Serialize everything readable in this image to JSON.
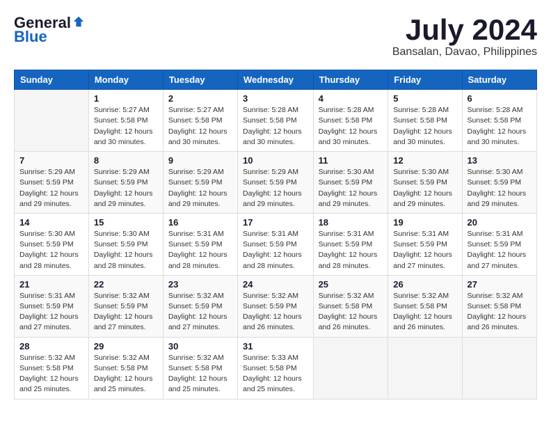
{
  "header": {
    "logo_general": "General",
    "logo_blue": "Blue",
    "month_year": "July 2024",
    "location": "Bansalan, Davao, Philippines"
  },
  "calendar": {
    "days_of_week": [
      "Sunday",
      "Monday",
      "Tuesday",
      "Wednesday",
      "Thursday",
      "Friday",
      "Saturday"
    ],
    "weeks": [
      [
        {
          "day": "",
          "info": ""
        },
        {
          "day": "1",
          "info": "Sunrise: 5:27 AM\nSunset: 5:58 PM\nDaylight: 12 hours\nand 30 minutes."
        },
        {
          "day": "2",
          "info": "Sunrise: 5:27 AM\nSunset: 5:58 PM\nDaylight: 12 hours\nand 30 minutes."
        },
        {
          "day": "3",
          "info": "Sunrise: 5:28 AM\nSunset: 5:58 PM\nDaylight: 12 hours\nand 30 minutes."
        },
        {
          "day": "4",
          "info": "Sunrise: 5:28 AM\nSunset: 5:58 PM\nDaylight: 12 hours\nand 30 minutes."
        },
        {
          "day": "5",
          "info": "Sunrise: 5:28 AM\nSunset: 5:58 PM\nDaylight: 12 hours\nand 30 minutes."
        },
        {
          "day": "6",
          "info": "Sunrise: 5:28 AM\nSunset: 5:58 PM\nDaylight: 12 hours\nand 30 minutes."
        }
      ],
      [
        {
          "day": "7",
          "info": "Sunrise: 5:29 AM\nSunset: 5:59 PM\nDaylight: 12 hours\nand 29 minutes."
        },
        {
          "day": "8",
          "info": "Sunrise: 5:29 AM\nSunset: 5:59 PM\nDaylight: 12 hours\nand 29 minutes."
        },
        {
          "day": "9",
          "info": "Sunrise: 5:29 AM\nSunset: 5:59 PM\nDaylight: 12 hours\nand 29 minutes."
        },
        {
          "day": "10",
          "info": "Sunrise: 5:29 AM\nSunset: 5:59 PM\nDaylight: 12 hours\nand 29 minutes."
        },
        {
          "day": "11",
          "info": "Sunrise: 5:30 AM\nSunset: 5:59 PM\nDaylight: 12 hours\nand 29 minutes."
        },
        {
          "day": "12",
          "info": "Sunrise: 5:30 AM\nSunset: 5:59 PM\nDaylight: 12 hours\nand 29 minutes."
        },
        {
          "day": "13",
          "info": "Sunrise: 5:30 AM\nSunset: 5:59 PM\nDaylight: 12 hours\nand 29 minutes."
        }
      ],
      [
        {
          "day": "14",
          "info": "Sunrise: 5:30 AM\nSunset: 5:59 PM\nDaylight: 12 hours\nand 28 minutes."
        },
        {
          "day": "15",
          "info": "Sunrise: 5:30 AM\nSunset: 5:59 PM\nDaylight: 12 hours\nand 28 minutes."
        },
        {
          "day": "16",
          "info": "Sunrise: 5:31 AM\nSunset: 5:59 PM\nDaylight: 12 hours\nand 28 minutes."
        },
        {
          "day": "17",
          "info": "Sunrise: 5:31 AM\nSunset: 5:59 PM\nDaylight: 12 hours\nand 28 minutes."
        },
        {
          "day": "18",
          "info": "Sunrise: 5:31 AM\nSunset: 5:59 PM\nDaylight: 12 hours\nand 28 minutes."
        },
        {
          "day": "19",
          "info": "Sunrise: 5:31 AM\nSunset: 5:59 PM\nDaylight: 12 hours\nand 27 minutes."
        },
        {
          "day": "20",
          "info": "Sunrise: 5:31 AM\nSunset: 5:59 PM\nDaylight: 12 hours\nand 27 minutes."
        }
      ],
      [
        {
          "day": "21",
          "info": "Sunrise: 5:31 AM\nSunset: 5:59 PM\nDaylight: 12 hours\nand 27 minutes."
        },
        {
          "day": "22",
          "info": "Sunrise: 5:32 AM\nSunset: 5:59 PM\nDaylight: 12 hours\nand 27 minutes."
        },
        {
          "day": "23",
          "info": "Sunrise: 5:32 AM\nSunset: 5:59 PM\nDaylight: 12 hours\nand 27 minutes."
        },
        {
          "day": "24",
          "info": "Sunrise: 5:32 AM\nSunset: 5:59 PM\nDaylight: 12 hours\nand 26 minutes."
        },
        {
          "day": "25",
          "info": "Sunrise: 5:32 AM\nSunset: 5:58 PM\nDaylight: 12 hours\nand 26 minutes."
        },
        {
          "day": "26",
          "info": "Sunrise: 5:32 AM\nSunset: 5:58 PM\nDaylight: 12 hours\nand 26 minutes."
        },
        {
          "day": "27",
          "info": "Sunrise: 5:32 AM\nSunset: 5:58 PM\nDaylight: 12 hours\nand 26 minutes."
        }
      ],
      [
        {
          "day": "28",
          "info": "Sunrise: 5:32 AM\nSunset: 5:58 PM\nDaylight: 12 hours\nand 25 minutes."
        },
        {
          "day": "29",
          "info": "Sunrise: 5:32 AM\nSunset: 5:58 PM\nDaylight: 12 hours\nand 25 minutes."
        },
        {
          "day": "30",
          "info": "Sunrise: 5:32 AM\nSunset: 5:58 PM\nDaylight: 12 hours\nand 25 minutes."
        },
        {
          "day": "31",
          "info": "Sunrise: 5:33 AM\nSunset: 5:58 PM\nDaylight: 12 hours\nand 25 minutes."
        },
        {
          "day": "",
          "info": ""
        },
        {
          "day": "",
          "info": ""
        },
        {
          "day": "",
          "info": ""
        }
      ]
    ]
  }
}
